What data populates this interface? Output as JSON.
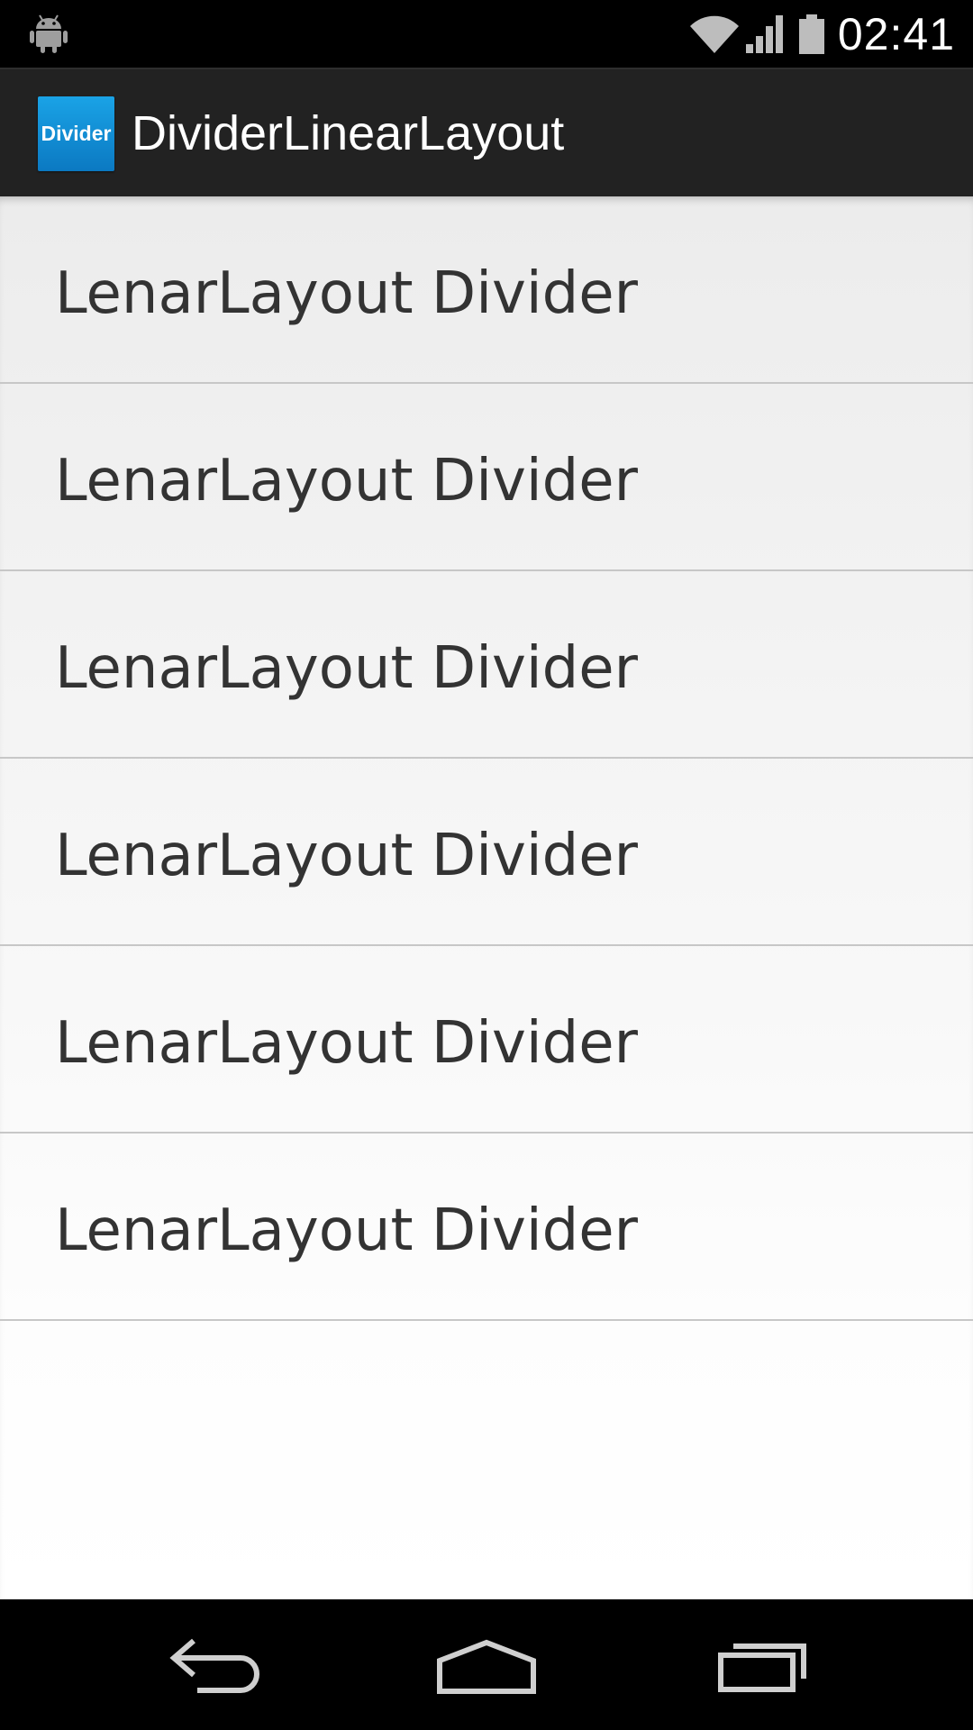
{
  "status_bar": {
    "time": "02:41",
    "icons": [
      "android-icon",
      "wifi-icon",
      "signal-icon",
      "battery-icon"
    ]
  },
  "action_bar": {
    "icon_label": "Divider",
    "title": "DividerLinearLayout",
    "icon_colors": [
      "#1aa3e6",
      "#0b79c2"
    ]
  },
  "list": {
    "items": [
      {
        "label": "LenarLayout Divider"
      },
      {
        "label": "LenarLayout Divider"
      },
      {
        "label": "LenarLayout Divider"
      },
      {
        "label": "LenarLayout Divider"
      },
      {
        "label": "LenarLayout Divider"
      },
      {
        "label": "LenarLayout Divider"
      }
    ]
  },
  "nav_bar": {
    "buttons": [
      "back-icon",
      "home-icon",
      "recents-icon"
    ]
  }
}
